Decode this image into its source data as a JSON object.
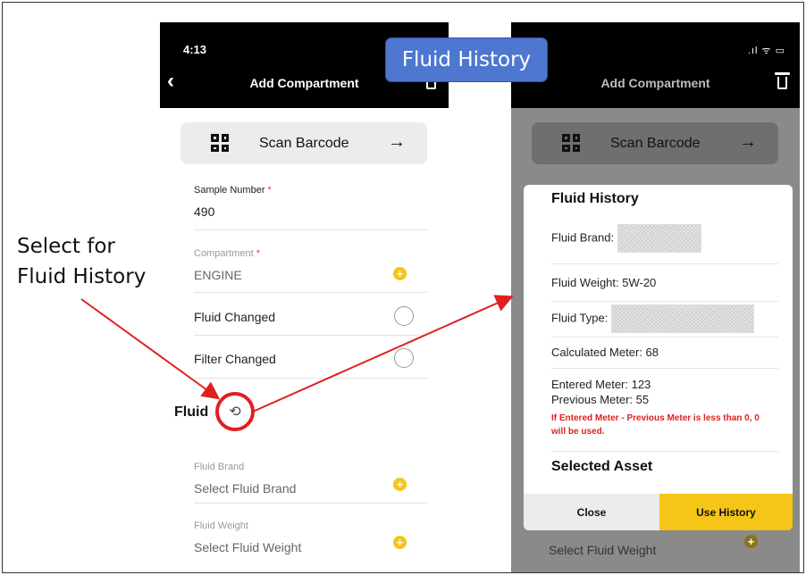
{
  "annotation": {
    "line1": "Select for",
    "line2": "Fluid History"
  },
  "callout": "Fluid History",
  "left_phone": {
    "time": "4:13",
    "header_title": "Add Compartment",
    "scan_label": "Scan Barcode",
    "sample_number": {
      "label": "Sample Number",
      "required": "*",
      "value": "490"
    },
    "compartment": {
      "label": "Compartment",
      "required": "*",
      "value": "ENGINE"
    },
    "fluid_changed": "Fluid Changed",
    "filter_changed": "Filter Changed",
    "section_fluid": "Fluid",
    "fluid_brand": {
      "label": "Fluid Brand",
      "placeholder": "Select Fluid Brand"
    },
    "fluid_weight": {
      "label": "Fluid Weight",
      "placeholder": "Select Fluid Weight"
    }
  },
  "right_phone": {
    "status_icons": ".ıl ᯤ ▭",
    "header_title": "Add Compartment",
    "scan_label": "Scan Barcode",
    "behind_placeholder": "Select Fluid Weight",
    "modal": {
      "title": "Fluid History",
      "fluid_brand_label": "Fluid Brand:",
      "fluid_weight": "Fluid Weight: 5W-20",
      "fluid_type_label": "Fluid Type:",
      "calculated_meter": "Calculated Meter: 68",
      "entered_meter": "Entered Meter: 123",
      "previous_meter": "Previous Meter: 55",
      "warning": "If Entered Meter - Previous Meter is less than 0, 0 will be used.",
      "selected_asset": "Selected Asset",
      "close_label": "Close",
      "use_history_label": "Use History"
    }
  },
  "icons": {
    "back": "‹",
    "arrow": "→",
    "plus": "+",
    "history": "⟲"
  },
  "colors": {
    "accent_yellow": "#f5c518",
    "highlight_red": "#e02020",
    "callout_blue": "#4e78cf"
  }
}
